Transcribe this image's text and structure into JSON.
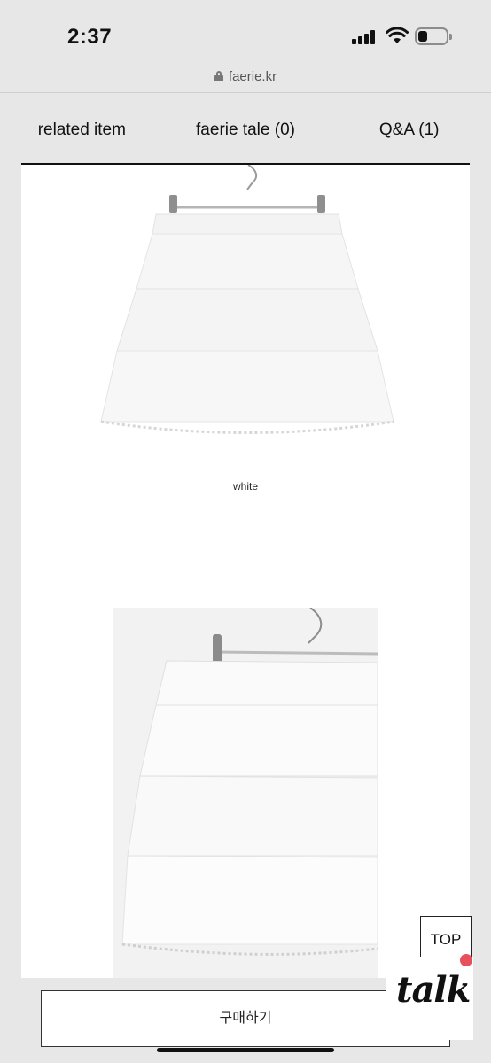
{
  "status_bar": {
    "time": "2:37",
    "battery_level": 0.25
  },
  "browser": {
    "url": "faerie.kr"
  },
  "tabs": [
    {
      "label": "related item"
    },
    {
      "label": "faerie tale (0)"
    },
    {
      "label": "Q&A (1)"
    }
  ],
  "product": {
    "images": [
      {
        "alt": "white"
      },
      {
        "alt": "white"
      }
    ],
    "color_caption": "white"
  },
  "floating": {
    "top_label": "TOP",
    "talk_label": "talk"
  },
  "bottom_bar": {
    "buy_label": "구매하기"
  },
  "colors": {
    "accent_dot": "#e8505b",
    "background": "#e7e7e7"
  }
}
